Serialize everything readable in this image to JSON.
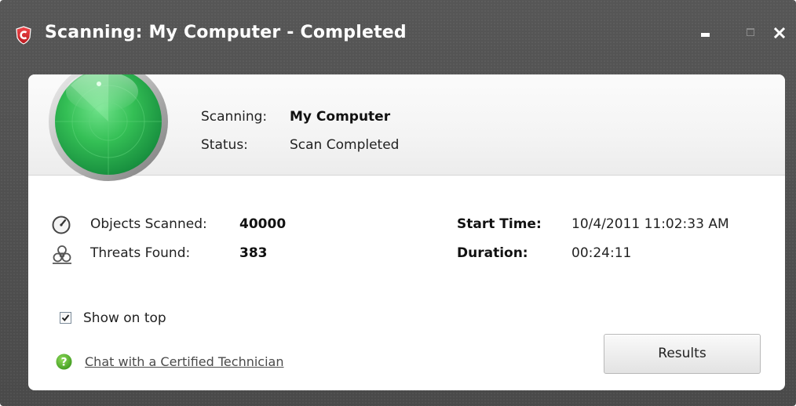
{
  "window": {
    "title": "Scanning: My Computer - Completed",
    "logo_icon": "comodo-shield-icon",
    "controls": [
      "minimize-icon",
      "maximize-icon",
      "close-icon"
    ]
  },
  "header": {
    "scanning_label": "Scanning:",
    "scanning_value": "My Computer",
    "status_label": "Status:",
    "status_value": "Scan Completed",
    "radar_icon": "radar-icon"
  },
  "stats": {
    "objects_scanned_label": "Objects Scanned:",
    "objects_scanned_value": "40000",
    "threats_found_label": "Threats Found:",
    "threats_found_value": "383",
    "start_time_label": "Start Time:",
    "start_time_value": "10/4/2011 11:02:33 AM",
    "duration_label": "Duration:",
    "duration_value": "00:24:11"
  },
  "options": {
    "show_on_top_label": "Show on top",
    "show_on_top_checked": true
  },
  "footer": {
    "chat_link": "Chat with a Certified Technician",
    "results_button": "Results"
  },
  "colors": {
    "window_frame": "#505050",
    "radar_green": "#2fb84a",
    "brand_red": "#d9262c"
  }
}
